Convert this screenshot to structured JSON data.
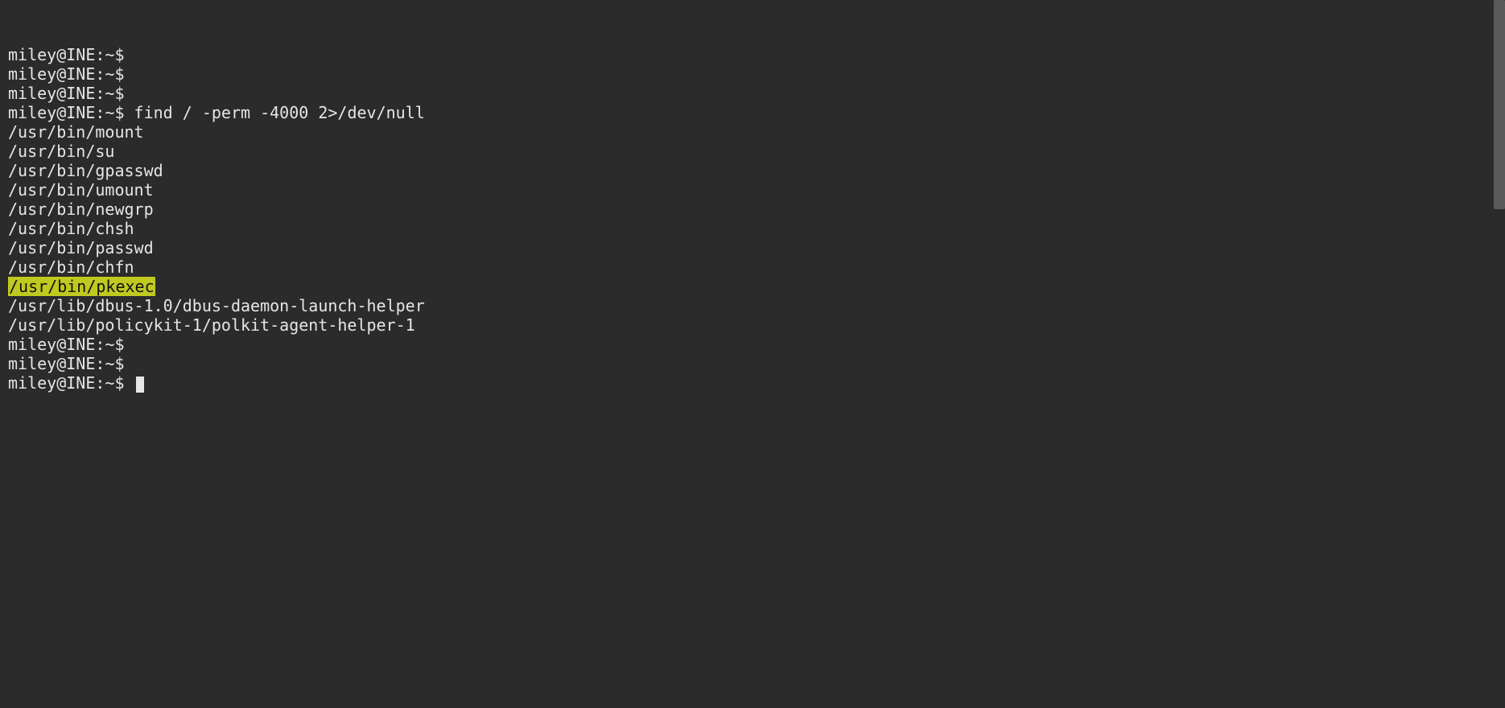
{
  "prompt": "miley@INE:~$",
  "lines": [
    {
      "type": "prompt",
      "text": ""
    },
    {
      "type": "prompt",
      "text": ""
    },
    {
      "type": "prompt",
      "text": ""
    },
    {
      "type": "prompt",
      "text": "find / -perm -4000 2>/dev/null"
    },
    {
      "type": "output",
      "text": "/usr/bin/mount"
    },
    {
      "type": "output",
      "text": "/usr/bin/su"
    },
    {
      "type": "output",
      "text": "/usr/bin/gpasswd"
    },
    {
      "type": "output",
      "text": "/usr/bin/umount"
    },
    {
      "type": "output",
      "text": "/usr/bin/newgrp"
    },
    {
      "type": "output",
      "text": "/usr/bin/chsh"
    },
    {
      "type": "output",
      "text": "/usr/bin/passwd"
    },
    {
      "type": "output",
      "text": "/usr/bin/chfn"
    },
    {
      "type": "highlight",
      "text": "/usr/bin/pkexec"
    },
    {
      "type": "output",
      "text": "/usr/lib/dbus-1.0/dbus-daemon-launch-helper"
    },
    {
      "type": "output",
      "text": "/usr/lib/policykit-1/polkit-agent-helper-1"
    },
    {
      "type": "prompt",
      "text": ""
    },
    {
      "type": "prompt",
      "text": ""
    },
    {
      "type": "prompt_cursor",
      "text": ""
    }
  ],
  "scrollbar": {
    "thumb_top": 0,
    "thumb_height": 260
  }
}
